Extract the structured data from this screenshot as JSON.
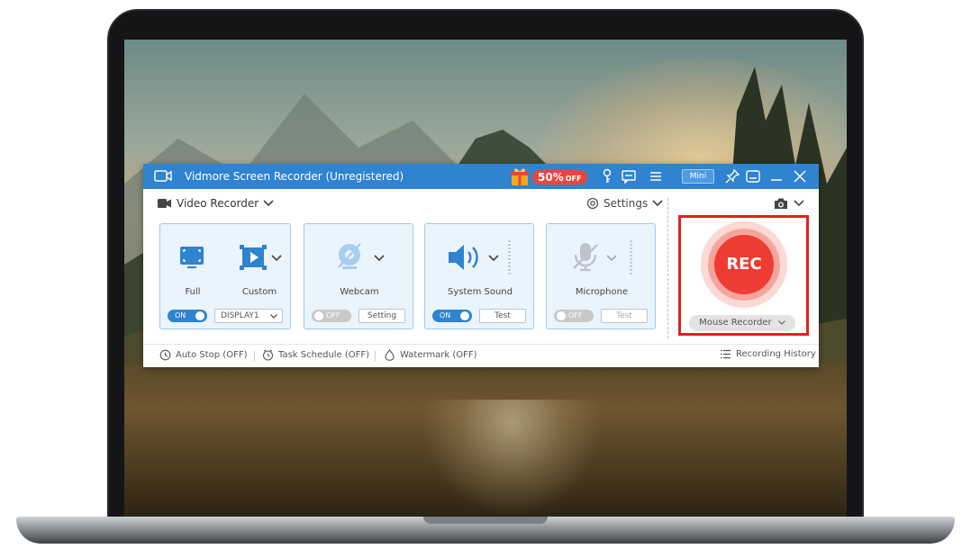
{
  "window": {
    "title": "Vidmore Screen Recorder (Unregistered)",
    "promo": {
      "percent": "50%",
      "suffix": "OFF",
      "color": "#e8473a"
    },
    "mini_label": "Mini",
    "titlebar_color": "#2f83cf"
  },
  "mode": {
    "label": "Video Recorder",
    "settings_label": "Settings"
  },
  "display": {
    "full_label": "Full",
    "custom_label": "Custom",
    "toggle": "ON",
    "display_select": "DISPLAY1"
  },
  "webcam": {
    "label": "Webcam",
    "toggle": "OFF",
    "setting_label": "Setting"
  },
  "system_sound": {
    "label": "System Sound",
    "toggle": "ON",
    "test_label": "Test"
  },
  "microphone": {
    "label": "Microphone",
    "toggle": "OFF",
    "test_label": "Test"
  },
  "record": {
    "rec_label": "REC",
    "mouse_recorder_label": "Mouse Recorder",
    "accent": "#ee3b33"
  },
  "footer": {
    "auto_stop": "Auto Stop (OFF)",
    "task_schedule": "Task Schedule (OFF)",
    "watermark": "Watermark (OFF)",
    "history": "Recording History"
  }
}
